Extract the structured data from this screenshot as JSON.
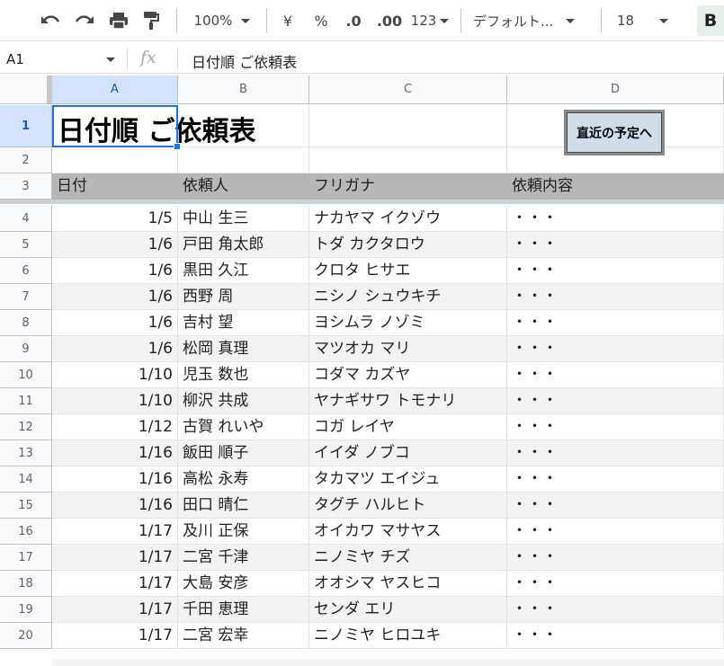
{
  "toolbar": {
    "zoom": "100%",
    "currency": "¥",
    "percent": "%",
    "decrease_decimal": ".0",
    "increase_decimal": ".00",
    "more_formats": "123",
    "font": "デフォルト...",
    "font_size": "18",
    "bold": "B"
  },
  "formula_bar": {
    "name_box": "A1",
    "fx": "fx",
    "content": "日付順 ご依頼表"
  },
  "columns": [
    "A",
    "B",
    "C",
    "D"
  ],
  "row_numbers": [
    "1",
    "2",
    "3",
    "4",
    "5",
    "6",
    "7",
    "8",
    "9",
    "10",
    "11",
    "12",
    "13",
    "14",
    "15",
    "16",
    "17",
    "18",
    "19",
    "20"
  ],
  "sheet": {
    "title": "日付順 ご依頼表",
    "button_label": "直近の予定へ",
    "headers": [
      "日付",
      "依頼人",
      "フリガナ",
      "依頼内容"
    ],
    "rows": [
      [
        "1/5",
        "中山 生三",
        "ナカヤマ イクゾウ",
        "・・・"
      ],
      [
        "1/6",
        "戸田 角太郎",
        "トダ カクタロウ",
        "・・・"
      ],
      [
        "1/6",
        "黒田 久江",
        "クロタ ヒサエ",
        "・・・"
      ],
      [
        "1/6",
        "西野 周",
        "ニシノ シュウキチ",
        "・・・"
      ],
      [
        "1/6",
        "吉村 望",
        "ヨシムラ ノゾミ",
        "・・・"
      ],
      [
        "1/6",
        "松岡 真理",
        "マツオカ マリ",
        "・・・"
      ],
      [
        "1/10",
        "児玉 数也",
        "コダマ カズヤ",
        "・・・"
      ],
      [
        "1/10",
        "柳沢 共成",
        "ヤナギサワ トモナリ",
        "・・・"
      ],
      [
        "1/12",
        "古賀 れいや",
        "コガ レイヤ",
        "・・・"
      ],
      [
        "1/16",
        "飯田 順子",
        "イイダ ノブコ",
        "・・・"
      ],
      [
        "1/16",
        "高松 永寿",
        "タカマツ エイジュ",
        "・・・"
      ],
      [
        "1/16",
        "田口 晴仁",
        "タグチ ハルヒト",
        "・・・"
      ],
      [
        "1/17",
        "及川 正保",
        "オイカワ マサヤス",
        "・・・"
      ],
      [
        "1/17",
        "二宮 千津",
        "ニノミヤ チズ",
        "・・・"
      ],
      [
        "1/17",
        "大島 安彦",
        "オオシマ ヤスヒコ",
        "・・・"
      ],
      [
        "1/17",
        "千田 恵理",
        "センダ エリ",
        "・・・"
      ],
      [
        "1/17",
        "二宮 宏幸",
        "ニノミヤ ヒロユキ",
        "・・・"
      ]
    ]
  },
  "colors": {
    "header_fill": "#b7b7b7",
    "band_fill": "#f3f3f3",
    "selection": "#1a73e8",
    "selected_header": "#d3e3fd",
    "button_face": "#cfdde9"
  }
}
